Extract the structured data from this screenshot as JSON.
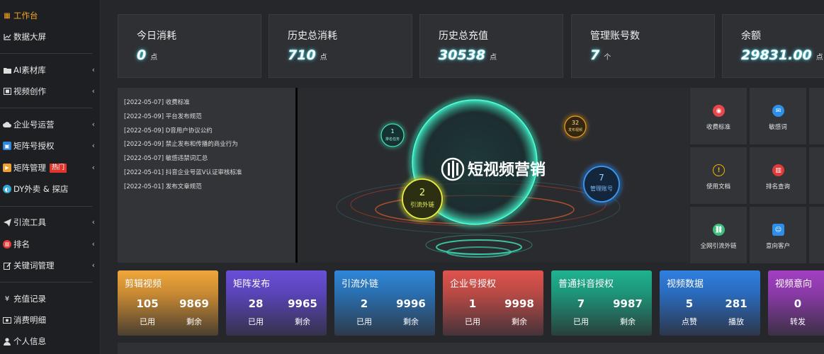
{
  "sidebar": {
    "items": [
      {
        "label": "工作台",
        "icon": "windows-icon",
        "active": true
      },
      {
        "label": "数据大屏",
        "icon": "line-chart-icon"
      },
      {
        "label": "AI素材库",
        "icon": "folder-icon"
      },
      {
        "label": "视频创作",
        "icon": "film-icon"
      },
      {
        "label": "企业号运营",
        "icon": "cloud-icon"
      },
      {
        "label": "矩阵号授权",
        "icon": "matrix-icon"
      },
      {
        "label": "矩阵管理",
        "icon": "play-icon",
        "badge": "热门"
      },
      {
        "label": "DY外卖 & 探店",
        "icon": "globe-icon"
      },
      {
        "label": "引流工具",
        "icon": "send-icon"
      },
      {
        "label": "排名",
        "icon": "bar-chart-icon"
      },
      {
        "label": "关键词管理",
        "icon": "edit-icon"
      },
      {
        "label": "充值记录",
        "icon": "yen-icon"
      },
      {
        "label": "消费明细",
        "icon": "money-icon"
      },
      {
        "label": "个人信息",
        "icon": "user-icon"
      }
    ]
  },
  "stats": [
    {
      "title": "今日消耗",
      "value": "0",
      "unit": "点"
    },
    {
      "title": "历史总消耗",
      "value": "710",
      "unit": "点"
    },
    {
      "title": "历史总充值",
      "value": "30538",
      "unit": "点"
    },
    {
      "title": "管理账号数",
      "value": "7",
      "unit": "个"
    },
    {
      "title": "余额",
      "value": "29831.00",
      "unit": "点"
    }
  ],
  "notices": [
    "[2022-05-07] 收费标准",
    "[2022-05-09] 平台发布规范",
    "[2022-05-09] D音用户协议公约",
    "[2022-05-09] 禁止发布和传播的商业行为",
    "[2022-05-07] 敏感违禁词汇总",
    "[2022-05-01] 抖音企业号蓝V认证审核标准",
    "[2022-05-01] 发布文章规范"
  ],
  "visual": {
    "brand": "短视频营销",
    "bubbles": [
      {
        "num": "1",
        "label": "排名任务"
      },
      {
        "num": "32",
        "label": "发布视频"
      },
      {
        "num": "2",
        "label": "引流外链"
      },
      {
        "num": "7",
        "label": "管理账号"
      }
    ]
  },
  "tiles": [
    {
      "label": "收费标准",
      "icon": "target-icon",
      "color": "#e8474a",
      "glyph": "◉"
    },
    {
      "label": "敏感词",
      "icon": "mail-icon",
      "color": "#2f8fe8",
      "glyph": "✉"
    },
    {
      "label": "使用文档",
      "icon": "alert-icon",
      "color": "#f0b400",
      "glyph": "!"
    },
    {
      "label": "排名查询",
      "icon": "bar-chart-icon",
      "color": "#e23a3a",
      "glyph": "▥"
    },
    {
      "label": "全网引流外链",
      "icon": "link-icon",
      "color": "#3cbf7a",
      "glyph": "⛓"
    },
    {
      "label": "意向客户",
      "icon": "contact-icon",
      "color": "#2f8fe8",
      "glyph": "☺"
    }
  ],
  "metrics": [
    {
      "title": "剪辑视频",
      "v1": "105",
      "l1": "已用",
      "v2": "9869",
      "l2": "剩余",
      "color": "#f0a63a"
    },
    {
      "title": "矩阵发布",
      "v1": "28",
      "l1": "已用",
      "v2": "9965",
      "l2": "剩余",
      "color": "#6a4ed8"
    },
    {
      "title": "引流外链",
      "v1": "2",
      "l1": "已用",
      "v2": "9996",
      "l2": "剩余",
      "color": "#2f86d8"
    },
    {
      "title": "企业号授权",
      "v1": "1",
      "l1": "已用",
      "v2": "9998",
      "l2": "剩余",
      "color": "#e0534d"
    },
    {
      "title": "普通抖音授权",
      "v1": "7",
      "l1": "已用",
      "v2": "9987",
      "l2": "剩余",
      "color": "#1fb391"
    },
    {
      "title": "视频数据",
      "v1": "5",
      "l1": "点赞",
      "v2": "281",
      "l2": "播放",
      "color": "#2f7fe0"
    },
    {
      "title": "视频意向",
      "v1": "0",
      "l1": "转发",
      "v2": "",
      "l2": "",
      "color": "#a23fc2"
    }
  ]
}
